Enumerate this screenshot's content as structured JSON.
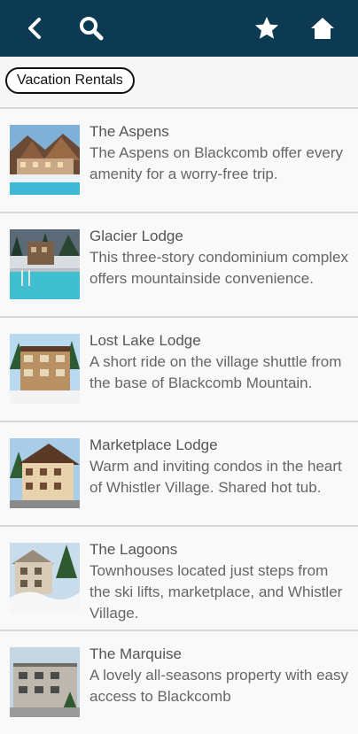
{
  "header": {
    "back_icon": "chevron-left-icon",
    "search_icon": "search-icon",
    "favorite_icon": "star-icon",
    "home_icon": "home-icon",
    "colors": {
      "bar": "#0b3a52",
      "icon": "#ffffff"
    }
  },
  "filter": {
    "chip_label": "Vacation Rentals"
  },
  "listings": [
    {
      "title": "The Aspens",
      "description": "The Aspens on Blackcomb offer every amenity for a worry-free trip."
    },
    {
      "title": "Glacier Lodge",
      "description": "This three-story condominium complex offers mountainside convenience."
    },
    {
      "title": "Lost Lake Lodge",
      "description": "A short ride on the village shuttle from the base of Blackcomb Mountain."
    },
    {
      "title": "Marketplace Lodge",
      "description": "Warm and inviting condos in the heart of Whistler Village. Shared hot tub."
    },
    {
      "title": "The Lagoons",
      "description": "Townhouses located just steps from the ski lifts, marketplace, and Whistler Village."
    },
    {
      "title": "The Marquise",
      "description": "A lovely all-seasons property with easy access to Blackcomb"
    }
  ]
}
